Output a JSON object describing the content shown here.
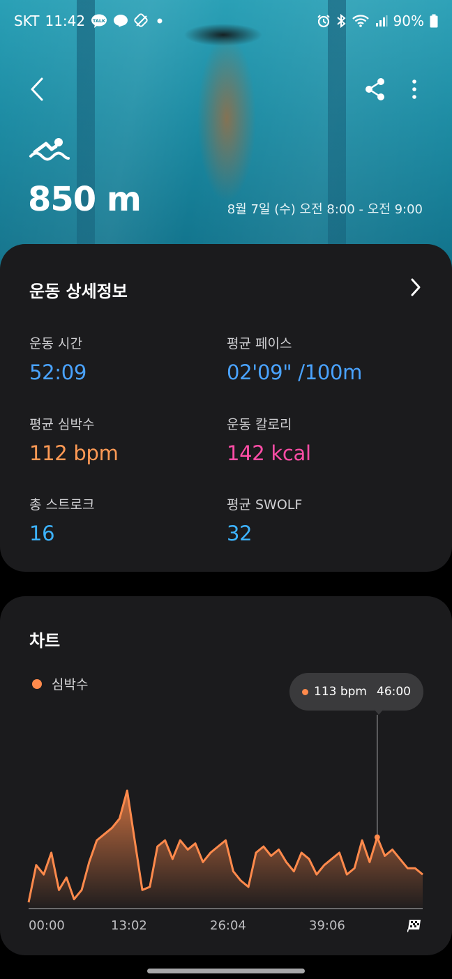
{
  "status_bar": {
    "carrier": "SKT",
    "time": "11:42",
    "battery": "90%",
    "icons": [
      "talk-icon",
      "messenger-icon",
      "bixby-icon",
      "dot-icon",
      "alarm-icon",
      "bluetooth-icon",
      "wifi-icon",
      "signal-icon",
      "battery-icon"
    ]
  },
  "hero": {
    "activity_icon": "swimming-icon",
    "distance": "850 m",
    "datetime": "8월 7일 (수) 오전 8:00 - 오전 9:00"
  },
  "toolbar": {
    "back_icon": "back-arrow-icon",
    "share_icon": "share-icon",
    "more_icon": "more-vertical-icon"
  },
  "details": {
    "title": "운동 상세정보",
    "stats": [
      {
        "label": "운동 시간",
        "value": "52:09",
        "color": "#4aa3ff"
      },
      {
        "label": "평균 페이스",
        "value": "02'09\" /100m",
        "color": "#4aa3ff"
      },
      {
        "label": "평균 심박수",
        "value": "112 bpm",
        "color": "#ff9a55"
      },
      {
        "label": "운동 칼로리",
        "value": "142 kcal",
        "color": "#ff4da6"
      },
      {
        "label": "총 스트로크",
        "value": "16",
        "color": "#3db3ff"
      },
      {
        "label": "평균 SWOLF",
        "value": "32",
        "color": "#3db3ff"
      }
    ]
  },
  "chart_section": {
    "title": "차트",
    "legend": "심박수",
    "tooltip": {
      "value": "113 bpm",
      "time": "46:00"
    }
  },
  "chart_data": {
    "type": "area",
    "title": "",
    "series": [
      {
        "name": "심박수",
        "color": "#ff8a4c",
        "x_minutes": [
          0,
          1,
          2,
          3,
          4,
          5,
          6,
          7,
          8,
          9,
          10,
          11,
          12,
          13,
          14,
          15,
          16,
          17,
          18,
          19,
          20,
          21,
          22,
          23,
          24,
          25,
          26,
          27,
          28,
          29,
          30,
          31,
          32,
          33,
          34,
          35,
          36,
          37,
          38,
          39,
          40,
          41,
          42,
          43,
          44,
          45,
          46,
          47,
          48,
          49,
          50,
          51,
          52
        ],
        "values": [
          92,
          104,
          101,
          108,
          96,
          100,
          93,
          96,
          105,
          112,
          114,
          116,
          119,
          128,
          112,
          96,
          97,
          110,
          112,
          106,
          112,
          109,
          111,
          105,
          108,
          110,
          112,
          102,
          99,
          97,
          108,
          110,
          107,
          109,
          105,
          102,
          108,
          106,
          101,
          104,
          106,
          108,
          101,
          103,
          112,
          105,
          113,
          107,
          109,
          106,
          103,
          103,
          101
        ]
      }
    ],
    "x_tick_labels": [
      "00:00",
      "13:02",
      "26:04",
      "39:06"
    ],
    "x_range_minutes": [
      0,
      52
    ],
    "y_range": [
      90,
      130
    ],
    "finish_marker_icon": "finish-flag-icon",
    "grid": false,
    "legend_position": "top-left"
  }
}
